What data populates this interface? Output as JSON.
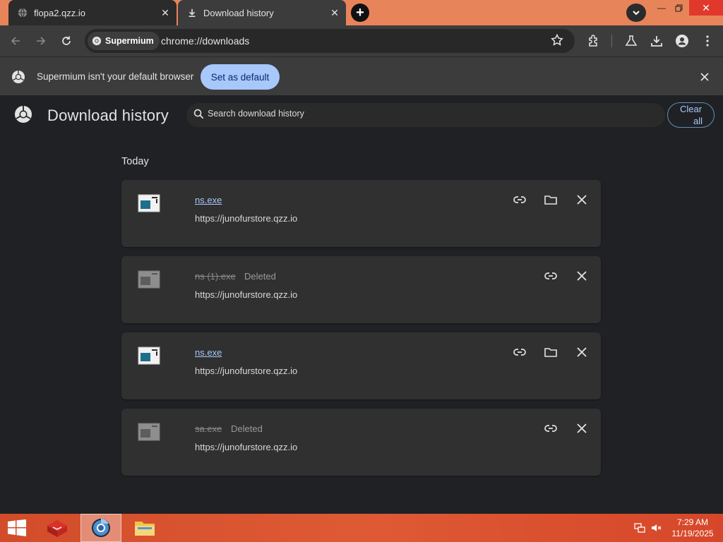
{
  "tabs": [
    {
      "title": "flopa2.qzz.io",
      "icon": "globe-icon",
      "active": false
    },
    {
      "title": "Download history",
      "icon": "download-icon",
      "active": true
    }
  ],
  "omnibox": {
    "chip_label": "Supermium",
    "url": "chrome://downloads"
  },
  "infobar": {
    "message": "Supermium isn't your default browser",
    "button_label": "Set as default"
  },
  "page": {
    "title": "Download history",
    "search_placeholder": "Search download history",
    "clear_all_line1": "Clear",
    "clear_all_line2": "all",
    "section_label": "Today"
  },
  "downloads": [
    {
      "filename": "ns.exe",
      "url": "https://junofurstore.qzz.io",
      "status": "",
      "deleted": false
    },
    {
      "filename": "ns (1).exe",
      "url": "https://junofurstore.qzz.io",
      "status": "Deleted",
      "deleted": true
    },
    {
      "filename": "ns.exe",
      "url": "https://junofurstore.qzz.io",
      "status": "",
      "deleted": false
    },
    {
      "filename": "sa.exe",
      "url": "https://junofurstore.qzz.io",
      "status": "Deleted",
      "deleted": true
    }
  ],
  "taskbar": {
    "time": "7:29 AM",
    "date": "11/19/2025"
  },
  "colors": {
    "accent": "#a8c7fa",
    "titlebar": "#e8845a",
    "page_bg": "#202124",
    "card_bg": "#303030",
    "close_red": "#e0392b"
  }
}
